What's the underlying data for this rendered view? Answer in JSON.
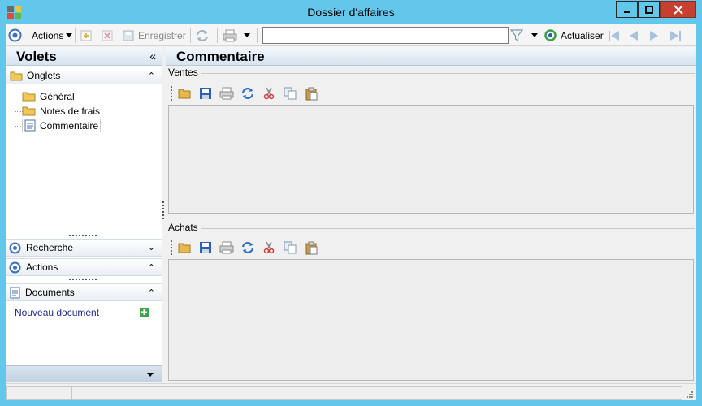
{
  "window": {
    "title": "Dossier d'affaires",
    "colors": {
      "frame": "#63c7ec",
      "close": "#c7402f"
    }
  },
  "toolbar": {
    "actions_label": "Actions",
    "save_label": "Enregistrer",
    "search_value": "",
    "refresh_label": "Actualiser"
  },
  "left_pane": {
    "title": "Volets",
    "onglets": {
      "label": "Onglets",
      "items": [
        {
          "label": "Général",
          "icon": "folder-icon"
        },
        {
          "label": "Notes de frais",
          "icon": "folder-icon"
        },
        {
          "label": "Commentaire",
          "icon": "document-icon",
          "selected": true
        }
      ]
    },
    "recherche_label": "Recherche",
    "actions_label": "Actions",
    "documents": {
      "label": "Documents",
      "new_document": "Nouveau document"
    }
  },
  "right_pane": {
    "title": "Commentaire",
    "sections": [
      {
        "label": "Ventes"
      },
      {
        "label": "Achats"
      }
    ]
  }
}
